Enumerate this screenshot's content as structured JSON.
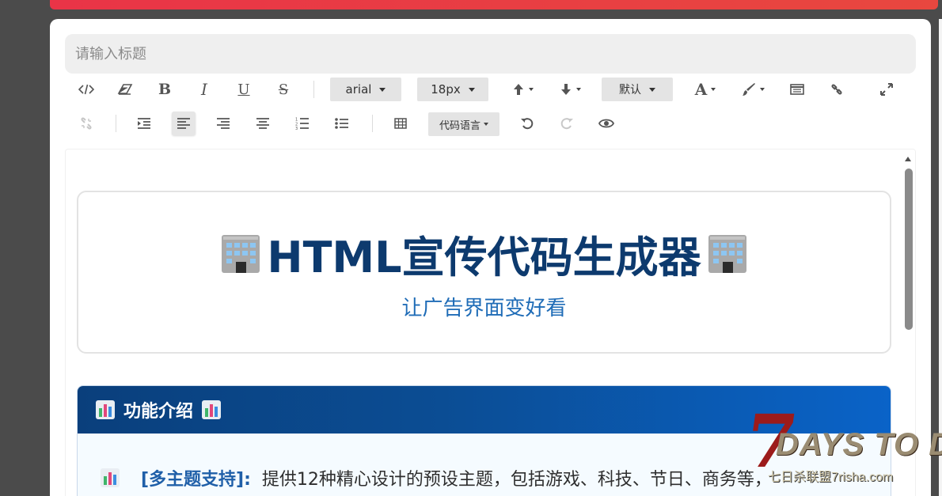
{
  "editor": {
    "title_placeholder": "请输入标题",
    "font_family": "arial",
    "font_size": "18px",
    "heading": "默认",
    "code_language": "代码语言"
  },
  "content": {
    "hero_title": "HTML宣传代码生成器",
    "hero_subtitle": "让广告界面变好看",
    "feature_heading": "功能介绍",
    "feature_items": [
      {
        "key": "[多主题支持]:",
        "desc": "提供12种精心设计的预设主题，包括游戏、科技、节日、商务等，"
      }
    ]
  },
  "watermark": {
    "logo_number": "7",
    "logo_text": "DAYS TO DIE",
    "url_text": "七日杀联盟7risha.com"
  },
  "colors": {
    "accent_red": "#e93447",
    "hero_title": "#0d3a6e",
    "hero_subtitle": "#1f6cb7",
    "feature_header": "#0a4d94"
  }
}
